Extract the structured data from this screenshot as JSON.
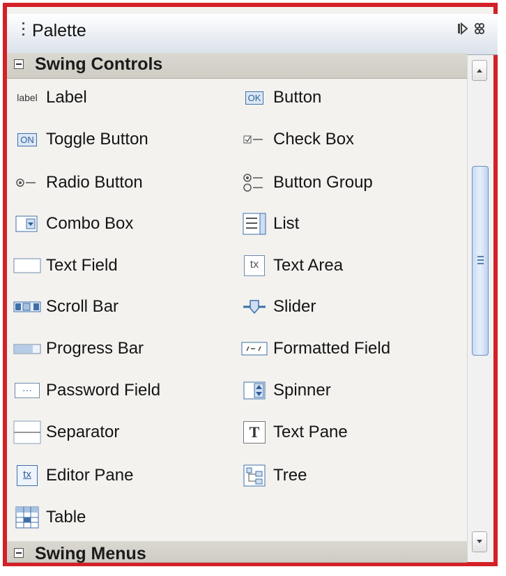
{
  "palette": {
    "title": "Palette",
    "toolbar_icons": [
      "dock-icon",
      "close-icon"
    ]
  },
  "sections": [
    {
      "label": "Swing Controls",
      "expanded": true
    },
    {
      "label": "Swing Menus",
      "expanded": true
    }
  ],
  "items": [
    {
      "label": "Label",
      "icon": "label-icon"
    },
    {
      "label": "Button",
      "icon": "button-icon"
    },
    {
      "label": "Toggle Button",
      "icon": "toggle-button-icon"
    },
    {
      "label": "Check Box",
      "icon": "check-box-icon"
    },
    {
      "label": "Radio Button",
      "icon": "radio-button-icon"
    },
    {
      "label": "Button Group",
      "icon": "button-group-icon"
    },
    {
      "label": "Combo Box",
      "icon": "combo-box-icon"
    },
    {
      "label": "List",
      "icon": "list-icon"
    },
    {
      "label": "Text Field",
      "icon": "text-field-icon"
    },
    {
      "label": "Text Area",
      "icon": "text-area-icon"
    },
    {
      "label": "Scroll Bar",
      "icon": "scroll-bar-icon"
    },
    {
      "label": "Slider",
      "icon": "slider-icon"
    },
    {
      "label": "Progress Bar",
      "icon": "progress-bar-icon"
    },
    {
      "label": "Formatted Field",
      "icon": "formatted-field-icon"
    },
    {
      "label": "Password Field",
      "icon": "password-field-icon"
    },
    {
      "label": "Spinner",
      "icon": "spinner-icon"
    },
    {
      "label": "Separator",
      "icon": "separator-icon"
    },
    {
      "label": "Text Pane",
      "icon": "text-pane-icon"
    },
    {
      "label": "Editor Pane",
      "icon": "editor-pane-icon"
    },
    {
      "label": "Tree",
      "icon": "tree-icon"
    },
    {
      "label": "Table",
      "icon": "table-icon"
    }
  ],
  "icon_text": {
    "label": "label",
    "button": "OK",
    "toggle": "ON",
    "text_area": "tx",
    "password": "···",
    "text_pane": "T",
    "editor_pane": "tx"
  },
  "colors": {
    "frame_border": "#d42027",
    "icon_blue": "#3f6fa8",
    "scroll_thumb": "#c9dcf2"
  }
}
